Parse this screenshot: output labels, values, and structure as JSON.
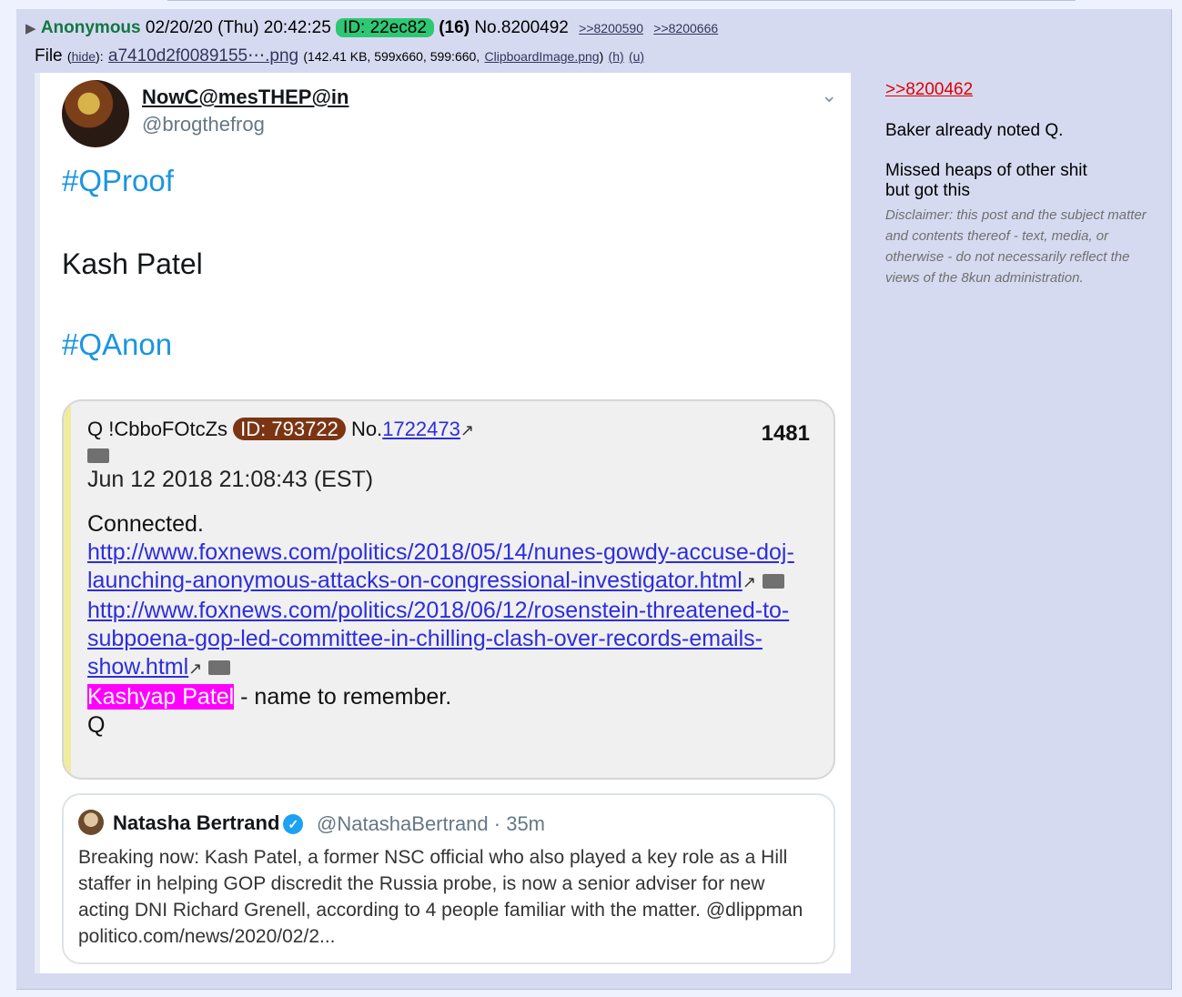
{
  "post": {
    "arrow": "▶",
    "name": "Anonymous",
    "datetime": "02/20/20 (Thu) 20:42:25",
    "id_label": "ID: 22ec82",
    "count": "(16)",
    "number": "No.8200492",
    "backlinks": [
      ">>8200590",
      ">>8200666"
    ],
    "file_label": "File",
    "hide": "hide",
    "filename": "a7410d2f0089155⋯.png",
    "filemeta_1": "(142.41 KB, 599x660, 599:660,",
    "filemeta_file": "ClipboardImage.png",
    "filemeta_h": "(h)",
    "filemeta_u": "(u)",
    "comment": {
      "reply_ref": ">>8200462",
      "line1": "Baker already noted Q.",
      "line2": "Missed heaps of other shit",
      "line3": "but got this",
      "disclaimer": "Disclaimer: this post and the subject matter and contents thereof - text, media, or otherwise - do not necessarily reflect the views of the 8kun administration."
    }
  },
  "tweet": {
    "display_name": "NowC@mesTHEP@in",
    "handle": "@brogthefrog",
    "hashtag1": "#QProof",
    "text": "Kash Patel",
    "hashtag2": "#QAnon",
    "q_card": {
      "tripcode": "Q !CbboFOtcZs",
      "id_label": "ID: 793722",
      "no_label": "No.",
      "no_link": "1722473",
      "drop_number": "1481",
      "date": "Jun 12 2018 21:08:43 (EST)",
      "connected": "Connected.",
      "link1": "http://www.foxnews.com/politics/2018/05/14/nunes-gowdy-accuse-doj-launching-anonymous-attacks-on-congressional-investigator.html",
      "link2": "http://www.foxnews.com/politics/2018/06/12/rosenstein-threatened-to-subpoena-gop-led-committee-in-chilling-clash-over-records-emails-show.html",
      "highlight": "Kashyap Patel",
      "after_highlight": " - name to remember.",
      "sign": "Q"
    },
    "quoted": {
      "name": "Natasha Bertrand",
      "handle_time": "@NatashaBertrand · 35m",
      "body": "Breaking now: Kash Patel, a former NSC official who also played a key role as a Hill staffer in helping GOP discredit the Russia probe, is now a senior adviser for new acting DNI Richard Grenell, according to 4 people familiar with the matter. @dlippman politico.com/news/2020/02/2..."
    }
  },
  "icons": [
    "arrow-icon",
    "chevron-down-icon",
    "folder-icon",
    "external-link-icon",
    "verified-icon"
  ],
  "colors": {
    "name": "#117743",
    "id_badge": "#2ec874",
    "q_id": "#7b3513",
    "highlight": "#ff00ff",
    "hashtag": "#1b95e0",
    "link": "#2d2ddc",
    "reply_ref": "#dd0000"
  }
}
